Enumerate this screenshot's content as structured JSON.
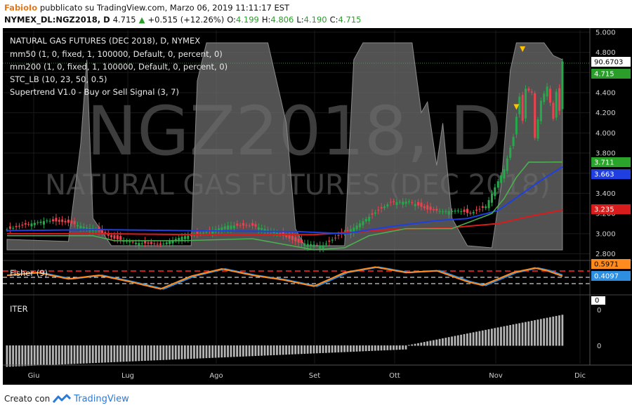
{
  "header": {
    "author": "FabioIo",
    "published": "pubblicato su TradingView.com, Marzo 06, 2019 11:11:17 EST",
    "symbol": "NYMEX_DL:NGZ2018, D",
    "last": "4.715",
    "change_arrow": "▲",
    "change": "+0.515 (+12.26%)",
    "o_label": "O:",
    "o": "4.199",
    "h_label": "H:",
    "h": "4.806",
    "l_label": "L:",
    "l": "4.190",
    "c_label": "C:",
    "c": "4.715"
  },
  "watermark": {
    "big": "NGZ2018, D",
    "small": "NATURAL GAS FUTURES (DEC 2018)"
  },
  "legend": [
    "NATURAL GAS FUTURES (DEC 2018), D, NYMEX",
    "mm50 (1, 0, fixed, 1, 100000, Default, 0, percent, 0)",
    "mm200 (1, 0, fixed, 1, 100000, Default, 0, percent, 0)",
    "STC_LB (10, 23, 50, 0.5)",
    "Supertrend V1.0 - Buy or Sell Signal (3, 7)"
  ],
  "fisher_label": "Fisher (9)",
  "iter_label": "ITER",
  "footer": {
    "created_with": "Creato con",
    "brand": "TradingView"
  },
  "colors": {
    "background": "#000000",
    "up_candle": "#26a94b",
    "down_candle": "#e8434e",
    "mm50": "#1f3fe0",
    "mm200": "#d81b1b",
    "supertrend": "#4caf50",
    "stc_fill": "#6e6e6e",
    "fisher_a": "#ff8a1e",
    "fisher_b": "#2e8fe0",
    "iter_bars": "#b5b5b5",
    "last_price": "#2a9d2a",
    "fisher_ref": "#ff2b2b"
  },
  "icons": [
    "tradingview-logo-icon",
    "sell-signal-triangle-icon",
    "buy-signal-triangle-icon"
  ],
  "chart_data": [
    {
      "type": "candlestick",
      "title": "NATURAL GAS FUTURES (DEC 2018), D, NYMEX",
      "ylim": [
        2.72,
        5.02
      ],
      "y_ticks": [
        "5.000",
        "4.800",
        "4.600",
        "4.400",
        "4.200",
        "4.000",
        "3.800",
        "3.600",
        "3.400",
        "3.200",
        "3.000",
        "2.800"
      ],
      "x_ticks": [
        "Giu",
        "Lug",
        "Ago",
        "Set",
        "Ott",
        "Nov",
        "Dic"
      ],
      "price_labels": [
        {
          "name": "cursor",
          "value": "90.6703",
          "color": "#ffffff",
          "text_color": "#000000"
        },
        {
          "name": "last",
          "value": "4.715",
          "color": "#2a9d2a",
          "text_color": "#ffffff"
        },
        {
          "name": "supertrend",
          "value": "3.711",
          "color": "#2aa42a",
          "text_color": "#ffffff"
        },
        {
          "name": "mm50",
          "value": "3.663",
          "color": "#1f3fe0",
          "text_color": "#ffffff"
        },
        {
          "name": "mm200",
          "value": "3.235",
          "color": "#d81b1b",
          "text_color": "#ffffff"
        }
      ],
      "close_anchors": [
        [
          0,
          3.04
        ],
        [
          6,
          3.09
        ],
        [
          13,
          3.13
        ],
        [
          20,
          3.11
        ],
        [
          26,
          3.06
        ],
        [
          28,
          3.05
        ],
        [
          35,
          2.95
        ],
        [
          42,
          2.91
        ],
        [
          50,
          2.89
        ],
        [
          57,
          2.97
        ],
        [
          63,
          3.0
        ],
        [
          72,
          3.08
        ],
        [
          80,
          3.08
        ],
        [
          87,
          3.02
        ],
        [
          95,
          2.91
        ],
        [
          103,
          2.88
        ],
        [
          108,
          2.98
        ],
        [
          113,
          3.06
        ],
        [
          120,
          3.21
        ],
        [
          125,
          3.31
        ],
        [
          131,
          3.32
        ],
        [
          137,
          3.24
        ],
        [
          142,
          3.22
        ],
        [
          147,
          3.23
        ],
        [
          151,
          3.2
        ],
        [
          156,
          3.27
        ],
        [
          159,
          3.46
        ],
        [
          162,
          3.64
        ],
        [
          165,
          3.96
        ],
        [
          167,
          4.36
        ],
        [
          168,
          4.12
        ],
        [
          169,
          4.44
        ],
        [
          171,
          4.4
        ],
        [
          172,
          3.95
        ],
        [
          174,
          4.32
        ],
        [
          176,
          4.46
        ],
        [
          178,
          4.14
        ],
        [
          179,
          4.41
        ],
        [
          180,
          4.22
        ],
        [
          181,
          4.71
        ]
      ],
      "mm50_anchors": [
        [
          0,
          3.03
        ],
        [
          30,
          3.04
        ],
        [
          60,
          3.03
        ],
        [
          95,
          3.02
        ],
        [
          110,
          3.0
        ],
        [
          125,
          3.07
        ],
        [
          140,
          3.13
        ],
        [
          150,
          3.15
        ],
        [
          160,
          3.23
        ],
        [
          168,
          3.4
        ],
        [
          175,
          3.55
        ],
        [
          181,
          3.663
        ]
      ],
      "mm200_anchors": [
        [
          0,
          3.0
        ],
        [
          30,
          3.0
        ],
        [
          60,
          2.99
        ],
        [
          100,
          2.99
        ],
        [
          125,
          3.04
        ],
        [
          145,
          3.06
        ],
        [
          160,
          3.1
        ],
        [
          170,
          3.17
        ],
        [
          181,
          3.235
        ]
      ],
      "supertrend_anchors": [
        [
          0,
          2.98
        ],
        [
          20,
          2.98
        ],
        [
          28,
          2.98
        ],
        [
          35,
          2.93
        ],
        [
          57,
          2.93
        ],
        [
          80,
          2.95
        ],
        [
          100,
          2.84
        ],
        [
          110,
          2.86
        ],
        [
          118,
          2.98
        ],
        [
          130,
          3.05
        ],
        [
          145,
          3.05
        ],
        [
          158,
          3.2
        ],
        [
          162,
          3.35
        ],
        [
          166,
          3.56
        ],
        [
          170,
          3.71
        ],
        [
          181,
          3.711
        ]
      ],
      "stc_anchors": [
        [
          0,
          0.05
        ],
        [
          20,
          0.04
        ],
        [
          24,
          0.5
        ],
        [
          26,
          0.9
        ],
        [
          28,
          0.15
        ],
        [
          34,
          0.02
        ],
        [
          60,
          0.02
        ],
        [
          62,
          0.8
        ],
        [
          65,
          0.98
        ],
        [
          85,
          0.98
        ],
        [
          91,
          0.6
        ],
        [
          94,
          0.1
        ],
        [
          97,
          0.02
        ],
        [
          110,
          0.02
        ],
        [
          113,
          0.9
        ],
        [
          116,
          0.98
        ],
        [
          132,
          0.98
        ],
        [
          135,
          0.65
        ],
        [
          137,
          0.7
        ],
        [
          140,
          0.4
        ],
        [
          142,
          0.6
        ],
        [
          145,
          0.15
        ],
        [
          150,
          0.02
        ],
        [
          158,
          0.01
        ],
        [
          161,
          0.3
        ],
        [
          164,
          0.85
        ],
        [
          166,
          0.98
        ],
        [
          175,
          0.98
        ],
        [
          178,
          0.92
        ],
        [
          181,
          0.9
        ]
      ],
      "sell_signal_index": 168,
      "buy_signal_index": 166
    },
    {
      "type": "line",
      "title": "Fisher (9)",
      "price_labels": [
        "0.5971",
        "0.4097"
      ],
      "series_a": [
        [
          0,
          0.3
        ],
        [
          10,
          0.6
        ],
        [
          20,
          -0.1
        ],
        [
          30,
          0.3
        ],
        [
          40,
          -0.4
        ],
        [
          50,
          -1.2
        ],
        [
          60,
          0.2
        ],
        [
          70,
          1.0
        ],
        [
          80,
          0.3
        ],
        [
          90,
          -0.2
        ],
        [
          100,
          -0.9
        ],
        [
          110,
          0.6
        ],
        [
          120,
          1.2
        ],
        [
          130,
          0.6
        ],
        [
          140,
          0.8
        ],
        [
          150,
          -0.4
        ],
        [
          155,
          -0.8
        ],
        [
          165,
          0.6
        ],
        [
          172,
          1.1
        ],
        [
          176,
          0.8
        ],
        [
          181,
          0.2
        ]
      ],
      "lag": 1
    },
    {
      "type": "bar",
      "title": "ITER",
      "y_ticks": [
        "0",
        "0"
      ],
      "value_label": "0",
      "trend": "rising from negative to positive",
      "bar_count": 182
    }
  ]
}
